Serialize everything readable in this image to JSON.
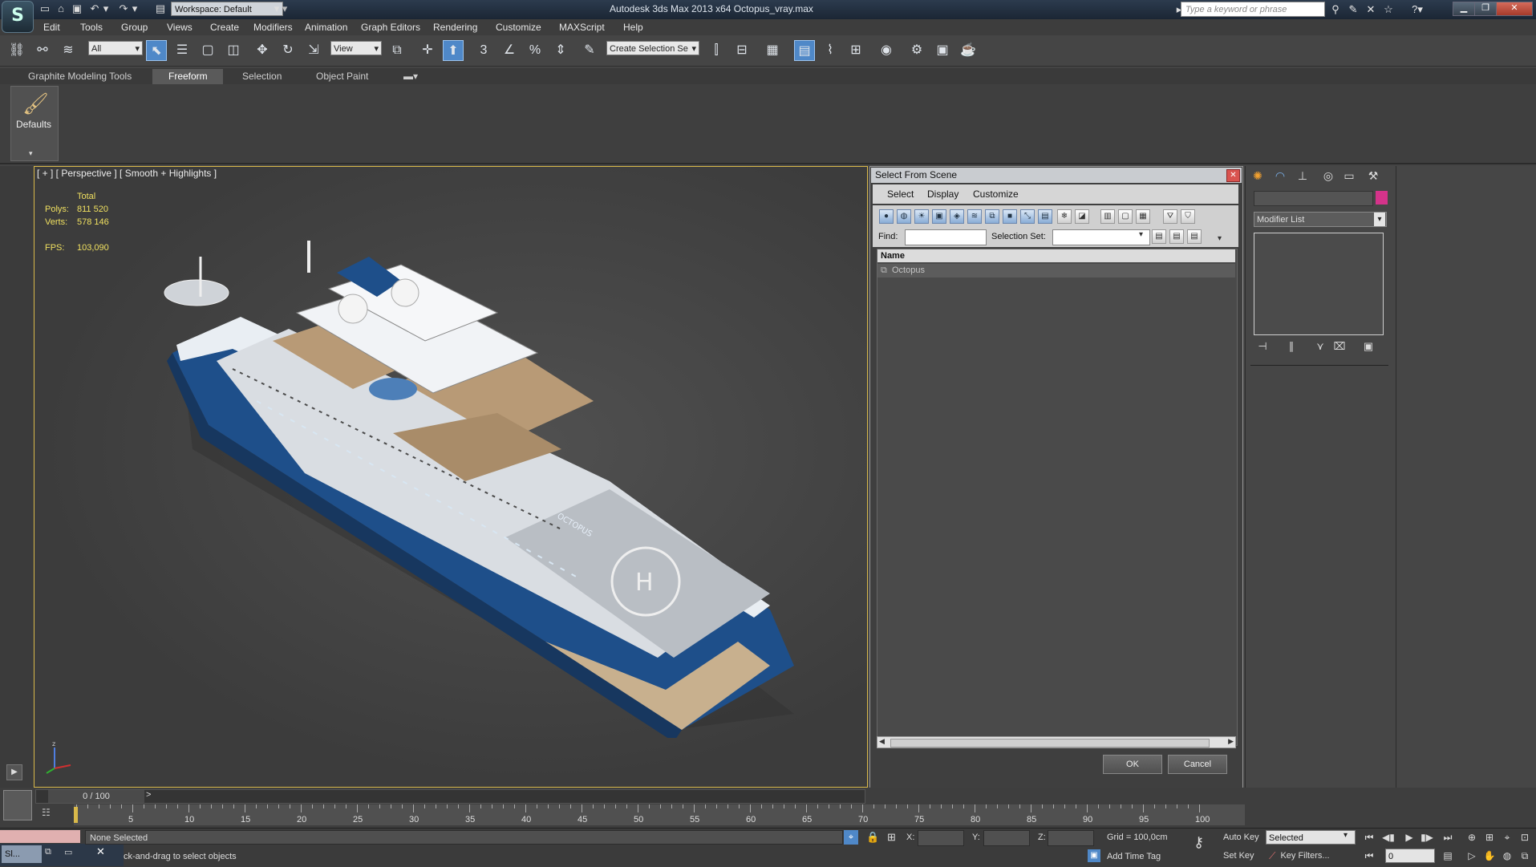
{
  "titlebar": {
    "workspace_label": "Workspace: Default",
    "window_title": "Autodesk 3ds Max  2013 x64      Octopus_vray.max",
    "search_placeholder": "Type a keyword or phrase",
    "logo_glyph": "S"
  },
  "menu": [
    "Edit",
    "Tools",
    "Group",
    "Views",
    "Create",
    "Modifiers",
    "Animation",
    "Graph Editors",
    "Rendering",
    "Customize",
    "MAXScript",
    "Help"
  ],
  "toolbar": {
    "filter_combo": "All",
    "refcoord_combo": "View",
    "snap_labels": [
      "3",
      "%"
    ],
    "named_selection": "Create Selection Se"
  },
  "ribbon": {
    "tabs": [
      "Graphite Modeling Tools",
      "Freeform",
      "Selection",
      "Object Paint"
    ],
    "active_tab": "Freeform",
    "defaults_label": "Defaults"
  },
  "viewport": {
    "label": "[ + ] [ Perspective ] [ Smooth + Highlights ]",
    "stats": {
      "header": "Total",
      "polys_label": "Polys:",
      "polys_value": "811 520",
      "verts_label": "Verts:",
      "verts_value": "578 146",
      "fps_label": "FPS:",
      "fps_value": "103,090"
    },
    "ship_name": "OCTOPUS",
    "helipad_letter": "H",
    "gizmo_axis_z": "z"
  },
  "dialog": {
    "title": "Select From Scene",
    "close_glyph": "✕",
    "menu": [
      "Select",
      "Display",
      "Customize"
    ],
    "find_label": "Find:",
    "selection_set_label": "Selection Set:",
    "column_name": "Name",
    "objects": [
      "Octopus"
    ],
    "ok_label": "OK",
    "cancel_label": "Cancel"
  },
  "command_panel": {
    "modifier_list_label": "Modifier List",
    "object_color": "#d4338a"
  },
  "timeline": {
    "slider_label": "0 / 100",
    "ticks": [
      0,
      5,
      10,
      15,
      20,
      25,
      30,
      35,
      40,
      45,
      50,
      55,
      60,
      65,
      70,
      75,
      80,
      85,
      90,
      95,
      100
    ]
  },
  "status": {
    "selection": "None Selected",
    "prompt": "ck-and-drag to select objects",
    "x_label": "X:",
    "y_label": "Y:",
    "z_label": "Z:",
    "grid": "Grid = 100,0cm",
    "add_time_tag": "Add Time Tag",
    "auto_key": "Auto Key",
    "set_key": "Set Key",
    "key_mode": "Selected",
    "key_filters": "Key Filters...",
    "frame": "0",
    "taskbar_item": "Sl..."
  },
  "colors": {
    "viewport_border": "#d9b94a",
    "hull_blue": "#1e4f8a",
    "deck_wood": "#b89a76"
  }
}
